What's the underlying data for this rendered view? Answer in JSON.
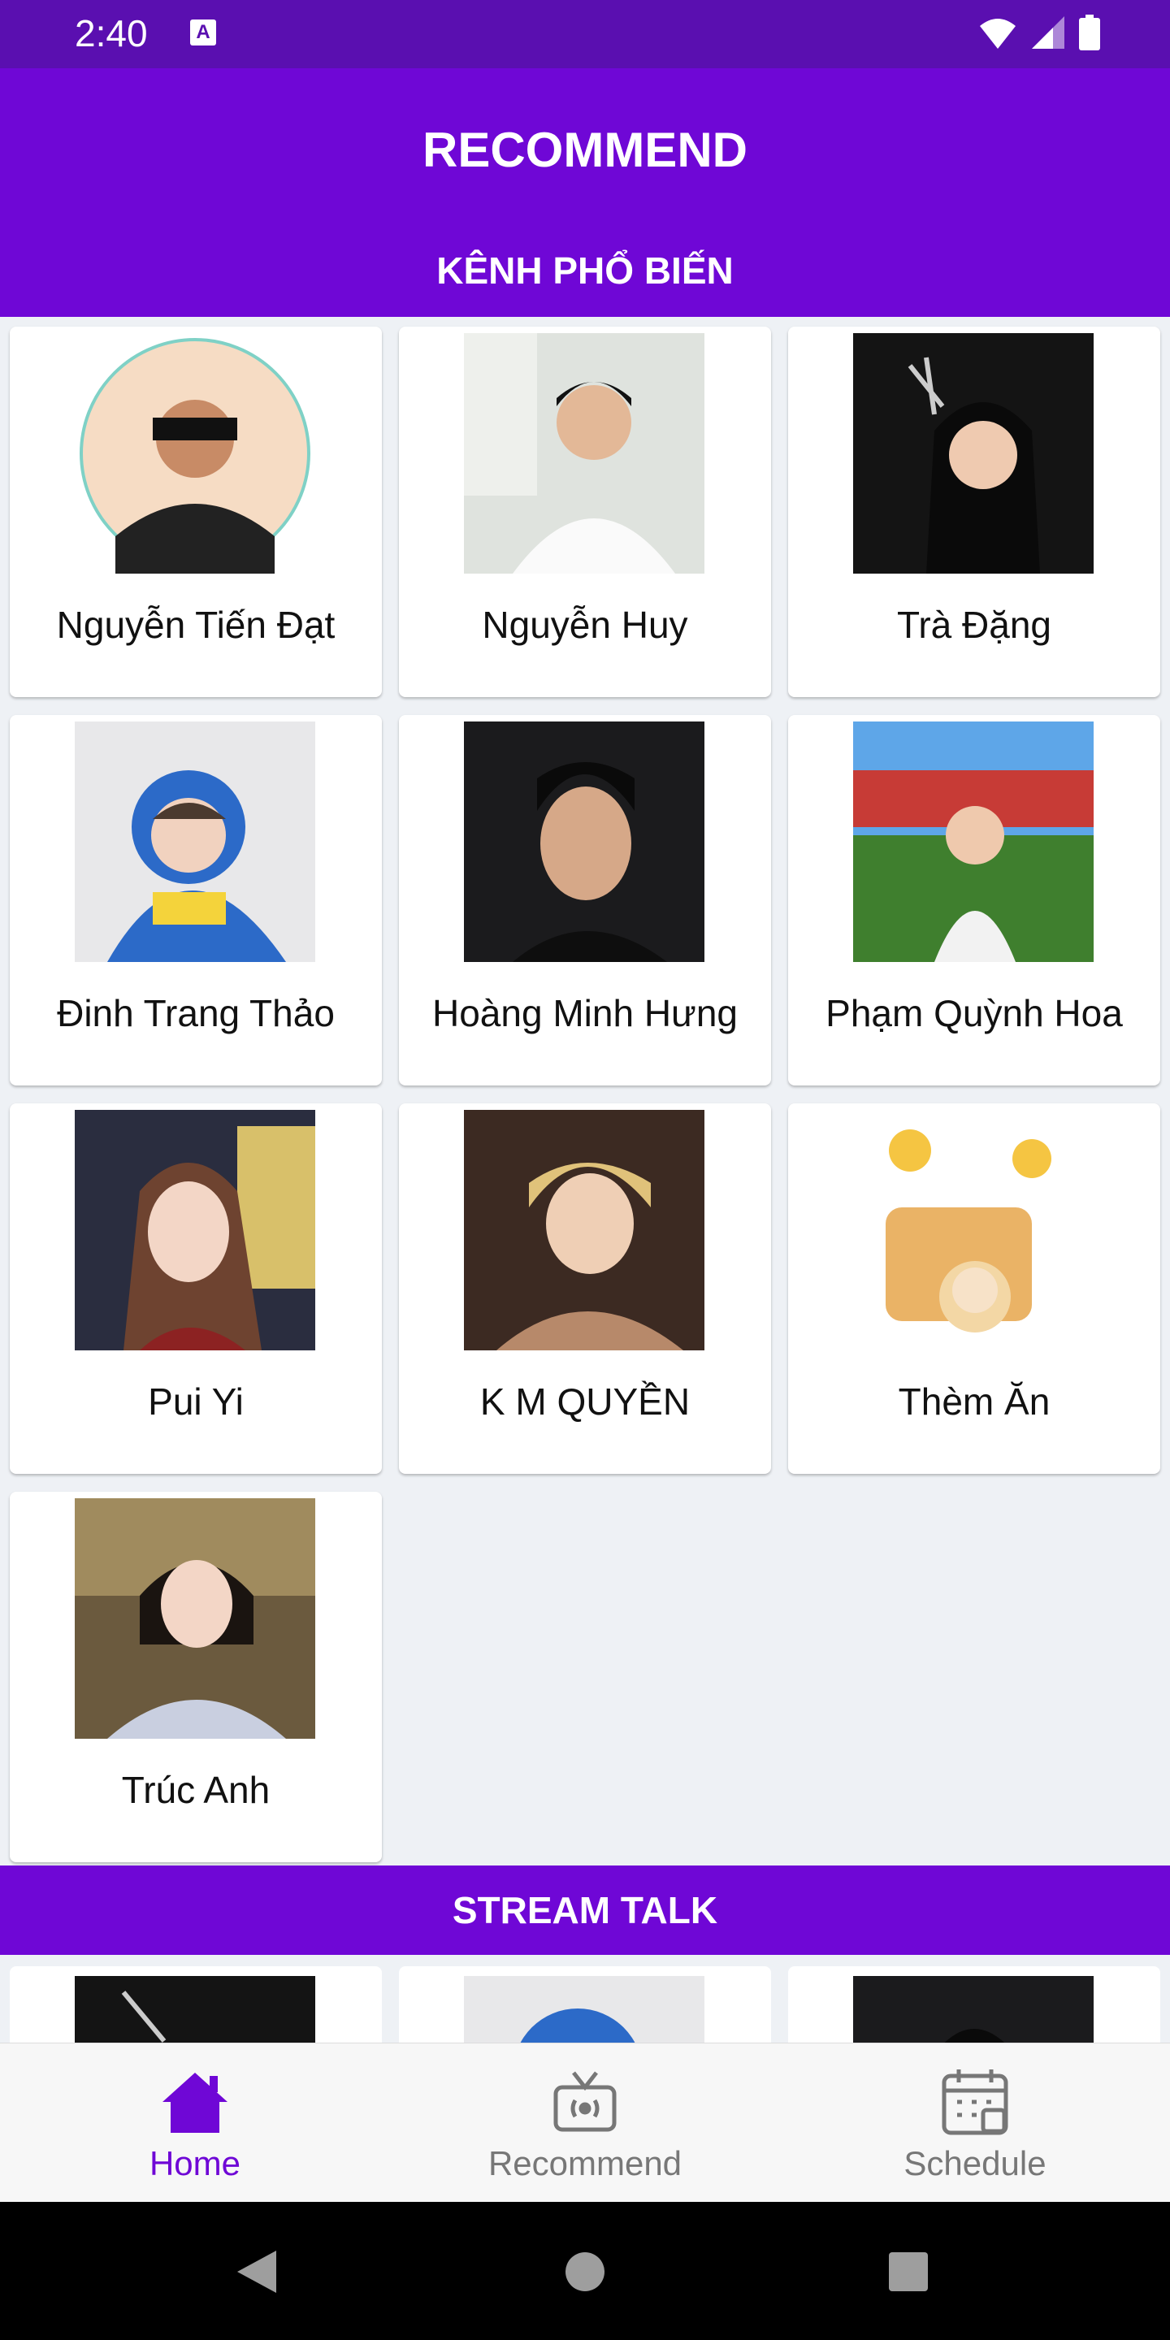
{
  "status": {
    "time": "2:40",
    "notif_letter": "A"
  },
  "header": {
    "title": "RECOMMEND",
    "section_title": "KÊNH PHỔ BIẾN"
  },
  "channels": [
    {
      "name": "Nguyễn Tiến Đạt"
    },
    {
      "name": "Nguyễn Huy"
    },
    {
      "name": "Trà Đặng"
    },
    {
      "name": "Đinh Trang Thảo"
    },
    {
      "name": "Hoàng Minh Hưng"
    },
    {
      "name": "Phạm Quỳnh Hoa"
    },
    {
      "name": "Pui Yi"
    },
    {
      "name": "K M QUYỀN"
    },
    {
      "name": "Thèm Ăn"
    },
    {
      "name": "Trúc Anh"
    }
  ],
  "stream": {
    "title": "STREAM TALK"
  },
  "nav": {
    "items": [
      {
        "label": "Home",
        "icon": "home-icon",
        "active": true
      },
      {
        "label": "Recommend",
        "icon": "tv-icon",
        "active": false
      },
      {
        "label": "Schedule",
        "icon": "calendar-icon",
        "active": false
      }
    ]
  },
  "colors": {
    "primary": "#6f07d6",
    "status_bar": "#5a0fb0",
    "background": "#eef1f5"
  }
}
